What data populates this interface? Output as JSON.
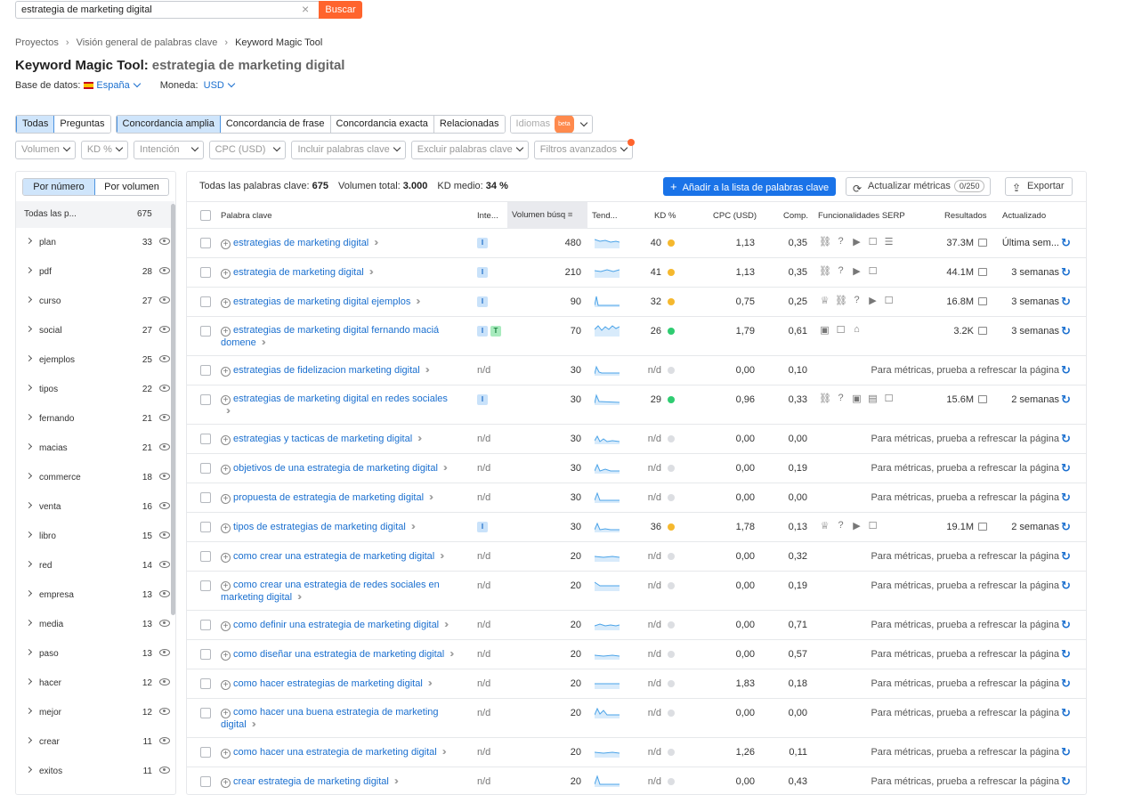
{
  "search": {
    "value": "estrategia de marketing digital",
    "clear": "×",
    "button": "Buscar"
  },
  "breadcrumb": [
    "Proyectos",
    "Visión general de palabras clave",
    "Keyword Magic Tool"
  ],
  "title": {
    "tool": "Keyword Magic Tool:",
    "query": "estrategia de marketing digital"
  },
  "database": {
    "label": "Base de datos:",
    "value": "España",
    "currency_label": "Moneda:",
    "currency": "USD"
  },
  "match_tabs": {
    "group1": [
      "Todas",
      "Preguntas"
    ],
    "group2": [
      "Concordancia amplia",
      "Concordancia de frase",
      "Concordancia exacta",
      "Relacionadas"
    ],
    "languages": "Idiomas",
    "beta": "beta"
  },
  "filters": [
    "Volumen",
    "KD %",
    "Intención",
    "CPC (USD)",
    "Incluir palabras clave",
    "Excluir palabras clave",
    "Filtros avanzados"
  ],
  "sidebar": {
    "toggle": [
      "Por número",
      "Por volumen"
    ],
    "header_label": "Todas las p...",
    "header_count": "675",
    "items": [
      {
        "label": "plan",
        "count": "33"
      },
      {
        "label": "pdf",
        "count": "28"
      },
      {
        "label": "curso",
        "count": "27"
      },
      {
        "label": "social",
        "count": "27"
      },
      {
        "label": "ejemplos",
        "count": "25"
      },
      {
        "label": "tipos",
        "count": "22"
      },
      {
        "label": "fernando",
        "count": "21"
      },
      {
        "label": "macias",
        "count": "21"
      },
      {
        "label": "commerce",
        "count": "18"
      },
      {
        "label": "venta",
        "count": "16"
      },
      {
        "label": "libro",
        "count": "15"
      },
      {
        "label": "red",
        "count": "14"
      },
      {
        "label": "empresa",
        "count": "13"
      },
      {
        "label": "media",
        "count": "13"
      },
      {
        "label": "paso",
        "count": "13"
      },
      {
        "label": "hacer",
        "count": "12"
      },
      {
        "label": "mejor",
        "count": "12"
      },
      {
        "label": "crear",
        "count": "11"
      },
      {
        "label": "exitos",
        "count": "11"
      }
    ]
  },
  "summary": {
    "all_label": "Todas las palabras clave:",
    "all_value": "675",
    "vol_label": "Volumen total:",
    "vol_value": "3.000",
    "kd_label": "KD medio:",
    "kd_value": "34 %"
  },
  "actions": {
    "add": "Añadir a la lista de palabras clave",
    "update": "Actualizar métricas",
    "counter": "0/250",
    "export": "Exportar"
  },
  "columns": {
    "keyword": "Palabra clave",
    "intent": "Inte...",
    "volume": "Volumen búsq",
    "trend": "Tend...",
    "kd": "KD %",
    "cpc": "CPC (USD)",
    "comp": "Comp.",
    "serp": "Funcionalidades SERP",
    "results": "Resultados",
    "updated": "Actualizado"
  },
  "colors": {
    "kd_yellow": "#f5b82e",
    "kd_green": "#2fcc71",
    "kd_na": "#dcdee2",
    "accent": "#1a73e8",
    "search_btn": "#ff642d"
  },
  "rows": [
    {
      "kw": "estrategias de marketing digital",
      "kw2": "",
      "intent": [
        "I"
      ],
      "vol": "480",
      "kd": "40",
      "kdc": "y",
      "cpc": "1,13",
      "comp": "0,35",
      "serp": [
        "link-icon",
        "question-icon",
        "video-icon",
        "review-icon",
        "list-icon"
      ],
      "res": "37.3M",
      "upd": "Última sem...",
      "h": 33
    },
    {
      "kw": "estrategia de marketing digital",
      "kw2": "",
      "intent": [
        "I"
      ],
      "vol": "210",
      "kd": "41",
      "kdc": "y",
      "cpc": "1,13",
      "comp": "0,35",
      "serp": [
        "link-icon",
        "question-icon",
        "video-icon",
        "review-icon"
      ],
      "res": "44.1M",
      "upd": "3 semanas",
      "h": 33
    },
    {
      "kw": "estrategias de marketing digital ejemplos",
      "kw2": "",
      "intent": [
        "I"
      ],
      "vol": "90",
      "kd": "32",
      "kdc": "y",
      "cpc": "0,75",
      "comp": "0,25",
      "serp": [
        "crown-icon",
        "link-icon",
        "question-icon",
        "video-icon",
        "review-icon"
      ],
      "res": "16.8M",
      "upd": "3 semanas",
      "h": 33
    },
    {
      "kw": "estrategias de marketing digital fernando maciá",
      "kw2": "domene",
      "intent": [
        "I",
        "T"
      ],
      "vol": "70",
      "kd": "26",
      "kdc": "g",
      "cpc": "1,79",
      "comp": "0,61",
      "serp": [
        "image-icon",
        "review-icon",
        "cap-icon"
      ],
      "res": "3.2K",
      "upd": "3 semanas",
      "h": 44
    },
    {
      "kw": "estrategias de fidelizacion marketing digital",
      "kw2": "",
      "intent": [],
      "vol": "30",
      "kd": "n/d",
      "kdc": "n",
      "cpc": "0,00",
      "comp": "0,10",
      "serp": [],
      "res": "",
      "upd": "",
      "h": 33
    },
    {
      "kw": "estrategias de marketing digital en redes sociales",
      "kw2": " ",
      "intent": [
        "I"
      ],
      "vol": "30",
      "kd": "29",
      "kdc": "g",
      "cpc": "0,96",
      "comp": "0,33",
      "serp": [
        "link-icon",
        "question-icon",
        "image-icon",
        "film-icon",
        "review-icon"
      ],
      "res": "15.6M",
      "upd": "2 semanas",
      "h": 44
    },
    {
      "kw": "estrategias y tacticas de marketing digital",
      "kw2": "",
      "intent": [],
      "vol": "30",
      "kd": "n/d",
      "kdc": "n",
      "cpc": "0,00",
      "comp": "0,00",
      "serp": [],
      "res": "",
      "upd": "",
      "h": 33
    },
    {
      "kw": "objetivos de una estrategia de marketing digital",
      "kw2": "",
      "intent": [],
      "vol": "30",
      "kd": "n/d",
      "kdc": "n",
      "cpc": "0,00",
      "comp": "0,19",
      "serp": [],
      "res": "",
      "upd": "",
      "h": 33
    },
    {
      "kw": "propuesta de estrategia de marketing digital",
      "kw2": "",
      "intent": [],
      "vol": "30",
      "kd": "n/d",
      "kdc": "n",
      "cpc": "0,00",
      "comp": "0,00",
      "serp": [],
      "res": "",
      "upd": "",
      "h": 33
    },
    {
      "kw": "tipos de estrategias de marketing digital",
      "kw2": "",
      "intent": [
        "I"
      ],
      "vol": "30",
      "kd": "36",
      "kdc": "y",
      "cpc": "1,78",
      "comp": "0,13",
      "serp": [
        "crown-icon",
        "question-icon",
        "video-icon",
        "review-icon"
      ],
      "res": "19.1M",
      "upd": "2 semanas",
      "h": 33
    },
    {
      "kw": "como crear una estrategia de marketing digital",
      "kw2": "",
      "intent": [],
      "vol": "20",
      "kd": "n/d",
      "kdc": "n",
      "cpc": "0,00",
      "comp": "0,32",
      "serp": [],
      "res": "",
      "upd": "",
      "h": 33
    },
    {
      "kw": "como crear una estrategia de redes sociales en",
      "kw2": "marketing digital",
      "intent": [],
      "vol": "20",
      "kd": "n/d",
      "kdc": "n",
      "cpc": "0,00",
      "comp": "0,19",
      "serp": [],
      "res": "",
      "upd": "",
      "h": 44
    },
    {
      "kw": "como definir una estrategia de marketing digital",
      "kw2": "",
      "intent": [],
      "vol": "20",
      "kd": "n/d",
      "kdc": "n",
      "cpc": "0,00",
      "comp": "0,71",
      "serp": [],
      "res": "",
      "upd": "",
      "h": 33
    },
    {
      "kw": "como diseñar una estrategia de marketing digital",
      "kw2": "",
      "intent": [],
      "vol": "20",
      "kd": "n/d",
      "kdc": "n",
      "cpc": "0,00",
      "comp": "0,57",
      "serp": [],
      "res": "",
      "upd": "",
      "h": 33
    },
    {
      "kw": "como hacer estrategias de marketing digital",
      "kw2": "",
      "intent": [],
      "vol": "20",
      "kd": "n/d",
      "kdc": "n",
      "cpc": "1,83",
      "comp": "0,18",
      "serp": [],
      "res": "",
      "upd": "",
      "h": 33
    },
    {
      "kw": "como hacer una buena estrategia de marketing",
      "kw2": "digital",
      "intent": [],
      "vol": "20",
      "kd": "n/d",
      "kdc": "n",
      "cpc": "0,00",
      "comp": "0,00",
      "serp": [],
      "res": "",
      "upd": "",
      "h": 44
    },
    {
      "kw": "como hacer una estrategia de marketing digital",
      "kw2": "",
      "intent": [],
      "vol": "20",
      "kd": "n/d",
      "kdc": "n",
      "cpc": "1,26",
      "comp": "0,11",
      "serp": [],
      "res": "",
      "upd": "",
      "h": 33
    },
    {
      "kw": "crear estrategia de marketing digital",
      "kw2": "",
      "intent": [],
      "vol": "20",
      "kd": "n/d",
      "kdc": "n",
      "cpc": "0,00",
      "comp": "0,43",
      "serp": [],
      "res": "",
      "upd": "",
      "h": 33
    }
  ],
  "na_text": "n/d",
  "refresh_msg": "Para métricas, prueba a refrescar la página"
}
